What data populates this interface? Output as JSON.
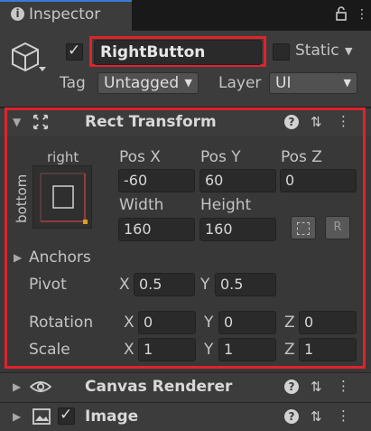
{
  "tab": {
    "title": "Inspector",
    "icon": "info-icon"
  },
  "header": {
    "name_value": "RightButton",
    "static_label": "Static",
    "tag_label": "Tag",
    "tag_value": "Untagged",
    "layer_label": "Layer",
    "layer_value": "UI"
  },
  "rect_transform": {
    "title": "Rect Transform",
    "anchor_preset": {
      "horizontal": "right",
      "vertical": "bottom"
    },
    "pos_x_label": "Pos X",
    "pos_y_label": "Pos Y",
    "pos_z_label": "Pos Z",
    "pos_x": "-60",
    "pos_y": "60",
    "pos_z": "0",
    "width_label": "Width",
    "height_label": "Height",
    "width": "160",
    "height": "160",
    "raw_edit_label": "R",
    "anchors_label": "Anchors",
    "pivot_label": "Pivot",
    "pivot_x_label": "X",
    "pivot_x": "0.5",
    "pivot_y_label": "Y",
    "pivot_y": "0.5",
    "rotation_label": "Rotation",
    "rotation": {
      "x_label": "X",
      "x": "0",
      "y_label": "Y",
      "y": "0",
      "z_label": "Z",
      "z": "0"
    },
    "scale_label": "Scale",
    "scale": {
      "x_label": "X",
      "x": "1",
      "y_label": "Y",
      "y": "1",
      "z_label": "Z",
      "z": "1"
    }
  },
  "components": [
    {
      "title": "Canvas Renderer",
      "icon": "eye-icon"
    },
    {
      "title": "Image",
      "icon": "image-icon"
    }
  ],
  "colors": {
    "highlight": "#e0222b",
    "accent": "#3a7bd5",
    "background": "#383838"
  }
}
